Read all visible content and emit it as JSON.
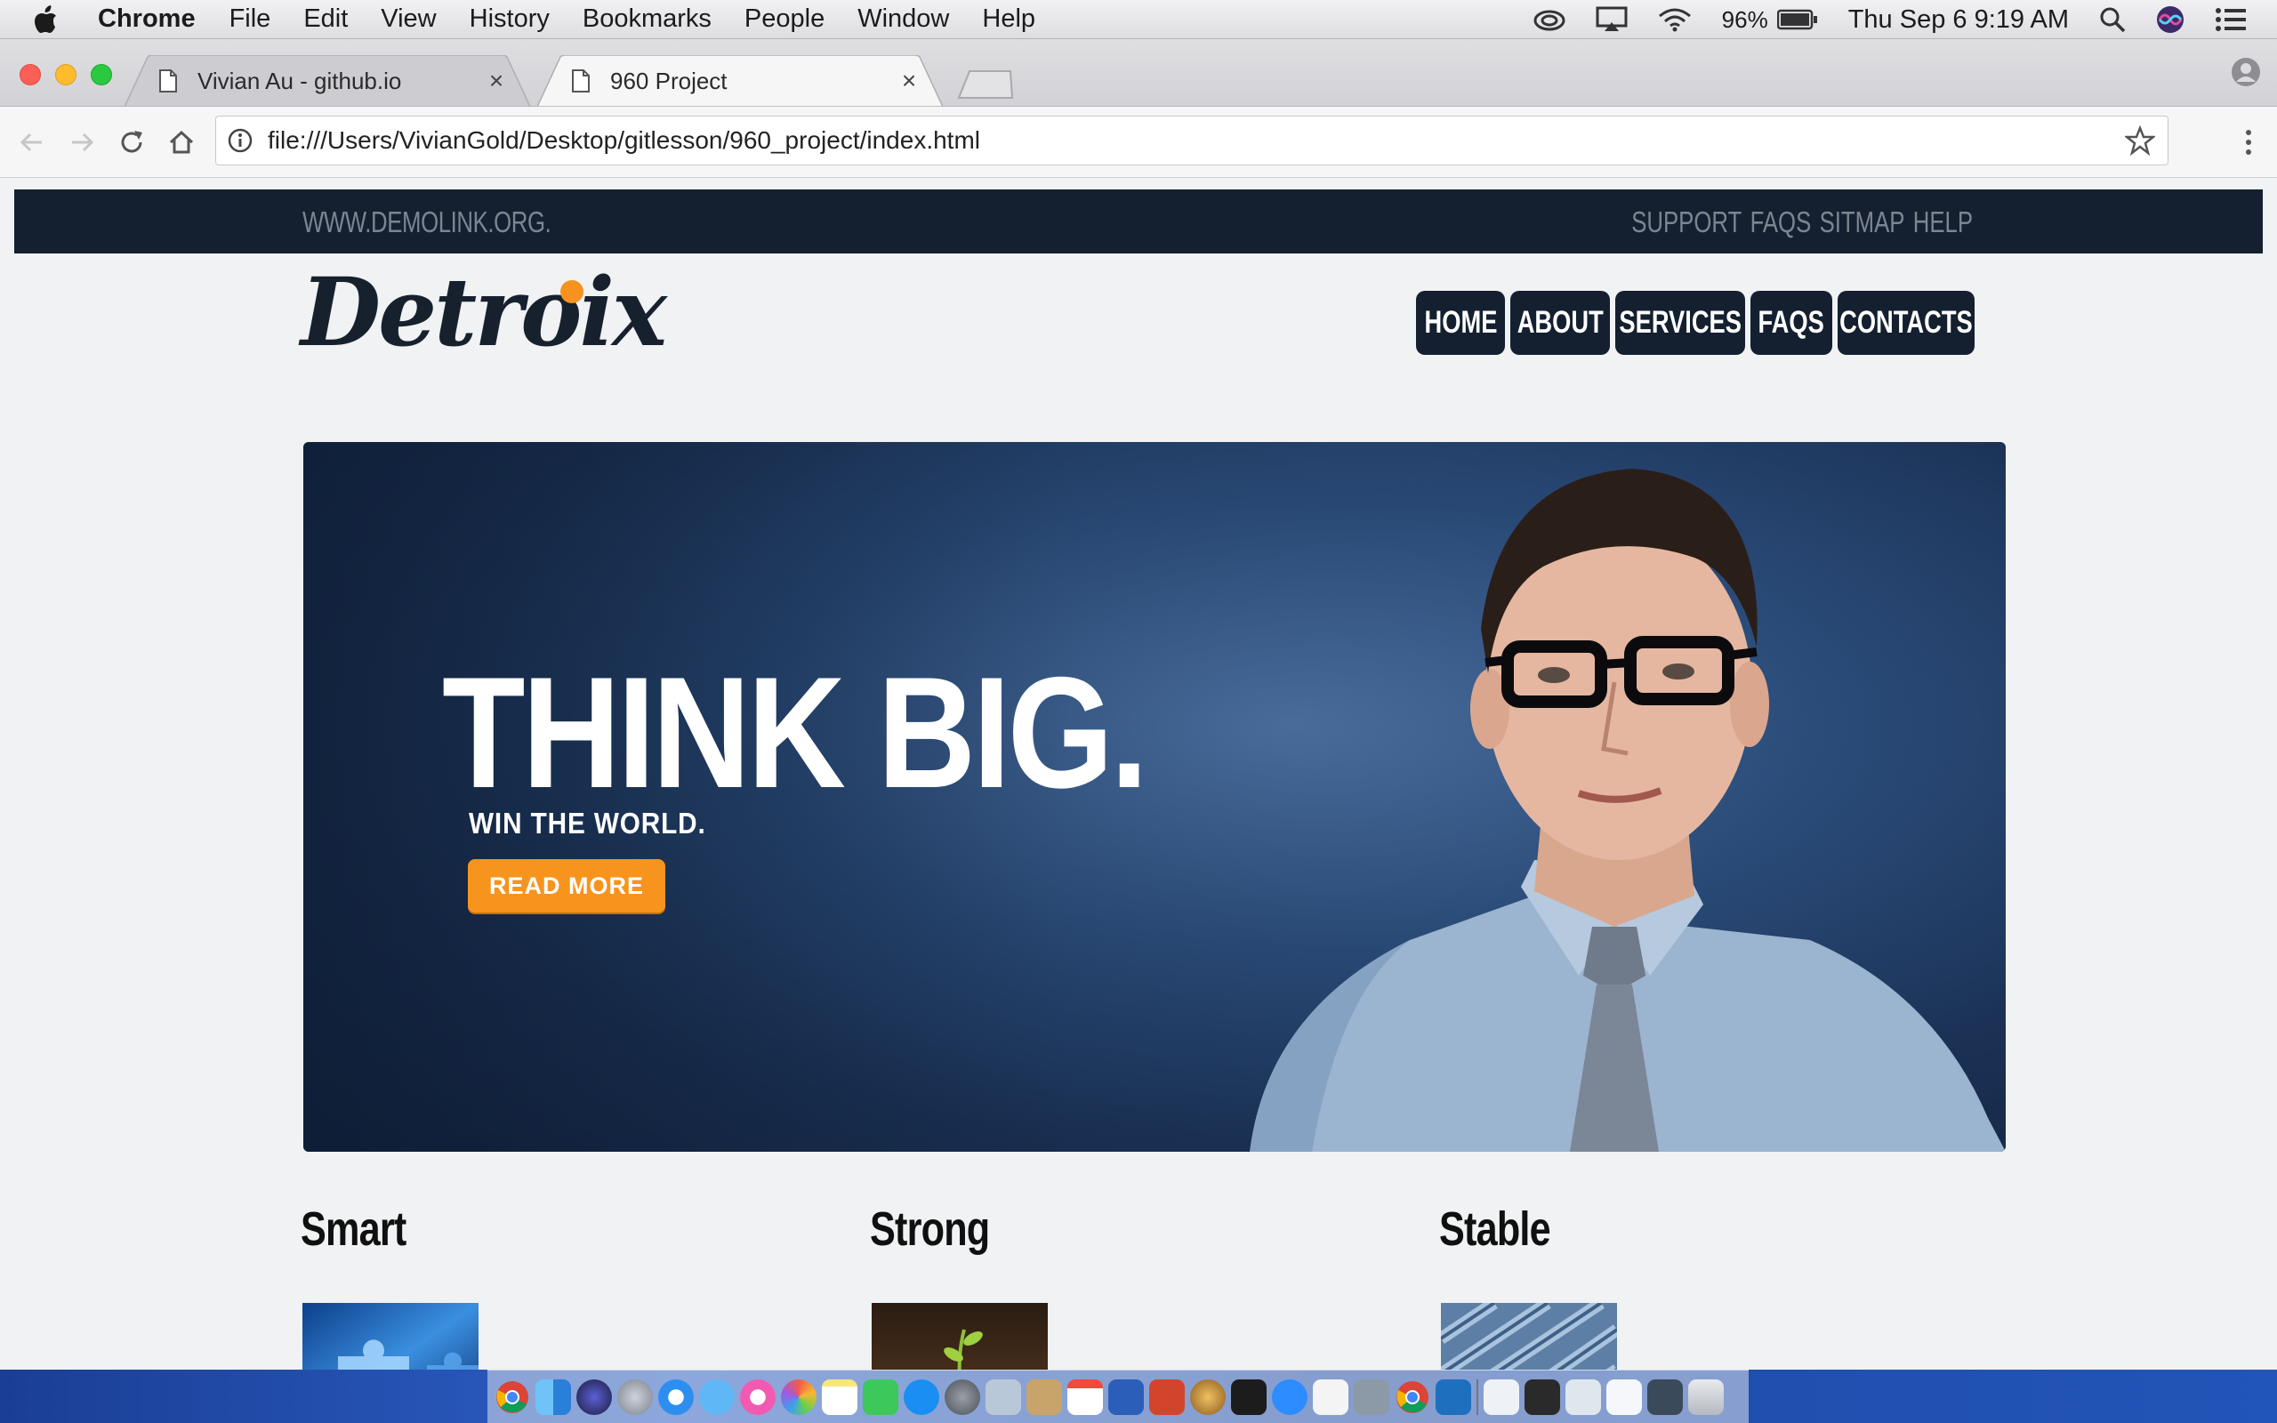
{
  "menubar": {
    "app_name": "Chrome",
    "menus": [
      "File",
      "Edit",
      "View",
      "History",
      "Bookmarks",
      "People",
      "Window",
      "Help"
    ],
    "battery": "96%",
    "datetime": "Thu Sep 6  9:19 AM"
  },
  "browser": {
    "tabs": [
      {
        "title": "Vivian Au - github.io",
        "close": "×"
      },
      {
        "title": "960 Project",
        "close": "×"
      }
    ],
    "url": "file:///Users/VivianGold/Desktop/gitlesson/960_project/index.html"
  },
  "page": {
    "topbar": {
      "link": "WWW.DEMOLINK.ORG.",
      "links": [
        "SUPPORT",
        "FAQS",
        "SITMAP",
        "HELP"
      ]
    },
    "logo": "Detroix",
    "nav": [
      "HOME",
      "ABOUT",
      "SERVICES",
      "FAQS",
      "CONTACTS"
    ],
    "hero": {
      "title": "THINK BIG.",
      "subtitle": "WIN THE WORLD.",
      "button": "READ MORE",
      "accent": "#f7941d"
    },
    "features": [
      {
        "title": "Smart"
      },
      {
        "title": "Strong"
      },
      {
        "title": "Stable"
      }
    ]
  },
  "colors": {
    "navy": "#142030",
    "orange": "#f6921e",
    "page_bg": "#f0f2f3"
  }
}
